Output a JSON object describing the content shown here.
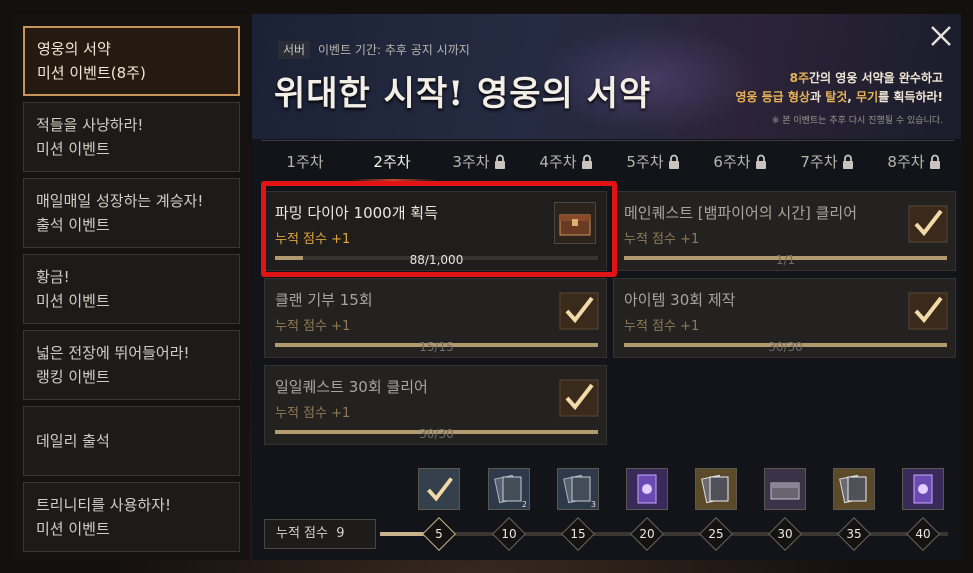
{
  "sidebar": {
    "items": [
      {
        "line1": "영웅의 서약",
        "line2": "미션 이벤트(8주)",
        "active": true
      },
      {
        "line1": "적들을 사냥하라!",
        "line2": "미션 이벤트"
      },
      {
        "line1": "매일매일 성장하는 계승자!",
        "line2": "출석 이벤트"
      },
      {
        "line1": "황금!",
        "line2": "미션 이벤트"
      },
      {
        "line1": "넓은 전장에 뛰어들어라!",
        "line2": "랭킹 이벤트"
      },
      {
        "line1": "데일리 출석",
        "line2": ""
      },
      {
        "line1": "트리니티를 사용하자!",
        "line2": "미션 이벤트"
      }
    ]
  },
  "banner": {
    "server": "서버",
    "period": "이벤트 기간: 추후 공지 시까지",
    "title": "위대한 시작! 영웅의 서약",
    "desc_line1_hl": "8주",
    "desc_line1_rest": "간의 영웅 서약을 완수하고",
    "desc_line2_hl1": "영웅 등급 형상",
    "desc_line2_mid": "과 ",
    "desc_line2_hl2": "탈것",
    "desc_line2_mid2": ", ",
    "desc_line2_hl3": "무기",
    "desc_line2_rest": "를 획득하라!",
    "notice": "※ 본 이벤트는 추후 다시 진행될 수 있습니다."
  },
  "tabs": [
    {
      "label": "1주차",
      "locked": false
    },
    {
      "label": "2주차",
      "locked": false,
      "active": true
    },
    {
      "label": "3주차",
      "locked": true
    },
    {
      "label": "4주차",
      "locked": true
    },
    {
      "label": "5주차",
      "locked": true
    },
    {
      "label": "6주차",
      "locked": true
    },
    {
      "label": "7주차",
      "locked": true
    },
    {
      "label": "8주차",
      "locked": true
    }
  ],
  "missions": [
    {
      "title": "파밍 다이아 1000개 획득",
      "score": "누적 점수 +1",
      "progress": "88/1,000",
      "fraction": 0.088,
      "done": false
    },
    {
      "title": "메인퀘스트 [뱀파이어의 시간] 클리어",
      "score": "누적 점수 +1",
      "progress": "1/1",
      "fraction": 1,
      "done": true
    },
    {
      "title": "클랜 기부 15회",
      "score": "누적 점수 +1",
      "progress": "15/15",
      "fraction": 1,
      "done": true
    },
    {
      "title": "아이템 30회 제작",
      "score": "누적 점수 +1",
      "progress": "30/30",
      "fraction": 1,
      "done": true
    },
    {
      "title": "일일퀘스트 30회 클리어",
      "score": "누적 점수 +1",
      "progress": "30/30",
      "fraction": 1,
      "done": true
    }
  ],
  "score": {
    "label": "누적 점수",
    "value": "9"
  },
  "milestones": [
    "5",
    "10",
    "15",
    "20",
    "25",
    "30",
    "35",
    "40"
  ],
  "reward_counts": [
    "",
    "2",
    "3",
    "",
    "",
    "",
    "",
    ""
  ],
  "colors": {
    "accent": "#e0a53e",
    "highlight": "#e01414",
    "active_border": "#c7955a"
  }
}
